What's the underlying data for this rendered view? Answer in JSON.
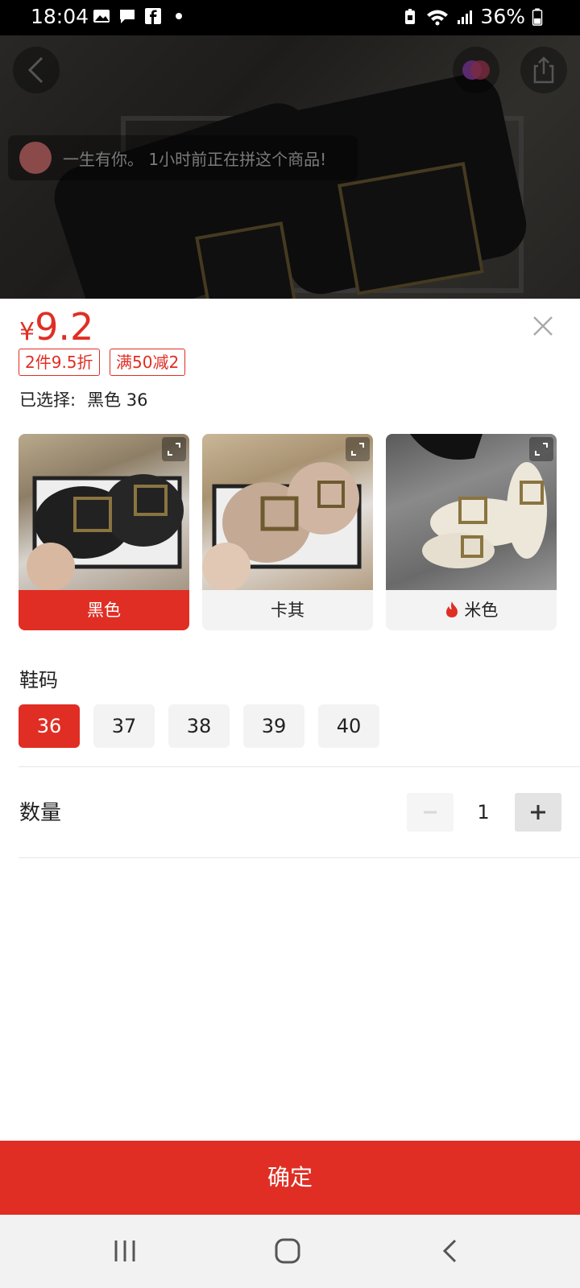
{
  "status_bar": {
    "time": "18:04",
    "battery": "36%"
  },
  "toast": {
    "text": "一生有你。 1小时前正在拼这个商品!"
  },
  "price": {
    "currency": "¥",
    "amount": "9.2"
  },
  "promos": [
    "2件9.5折",
    "满50减2"
  ],
  "selected": {
    "label": "已选择:",
    "value": "黑色 36"
  },
  "colors": [
    {
      "label": "黑色",
      "selected": true,
      "hot": false
    },
    {
      "label": "卡其",
      "selected": false,
      "hot": false
    },
    {
      "label": "米色",
      "selected": false,
      "hot": true
    }
  ],
  "size": {
    "title": "鞋码",
    "options": [
      "36",
      "37",
      "38",
      "39",
      "40"
    ],
    "selected": "36"
  },
  "quantity": {
    "title": "数量",
    "value": "1"
  },
  "confirm_label": "确定",
  "colors_hex": {
    "accent": "#e02e24"
  },
  "icons": [
    "back-icon",
    "share-icon",
    "close-icon",
    "expand-icon",
    "fire-icon",
    "minus-icon",
    "plus-icon"
  ]
}
